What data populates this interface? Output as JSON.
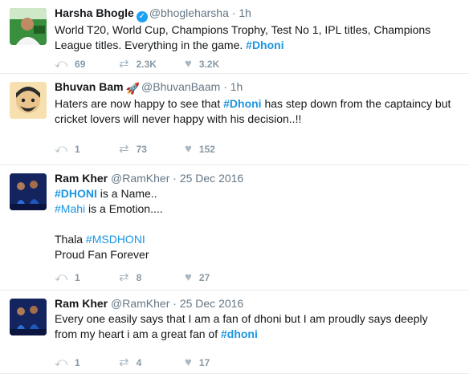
{
  "tweets": [
    {
      "name": "Harsha Bhogle",
      "verified": true,
      "handle": "@bhogleharsha",
      "dot": "·",
      "time": "1h",
      "lines": [
        {
          "parts": [
            {
              "t": "World T20, World Cup, Champions Trophy, Test No 1, IPL titles, Champions"
            }
          ]
        },
        {
          "parts": [
            {
              "t": "League titles. Everything in the game. "
            },
            {
              "t": "#Dhoni",
              "tag": true
            }
          ]
        }
      ],
      "replies": "69",
      "retweets": "2.3K",
      "likes": "3.2K"
    },
    {
      "name": "Bhuvan Bam",
      "emoji": "🚀",
      "handle": "@BhuvanBaam",
      "dot": "·",
      "time": "1h",
      "lines": [
        {
          "parts": [
            {
              "t": "Haters are now happy to see that "
            },
            {
              "t": "#Dhoni",
              "tag": true
            },
            {
              "t": " has step down from the captaincy but"
            }
          ]
        },
        {
          "parts": [
            {
              "t": "cricket lovers will never happy with his decision..!!"
            }
          ]
        }
      ],
      "replies": "1",
      "retweets": "73",
      "likes": "152"
    },
    {
      "name": "Ram Kher",
      "handle": "@RamKher",
      "dot": "·",
      "time": "25 Dec 2016",
      "lines": [
        {
          "parts": [
            {
              "t": "#DHONI",
              "tag": true
            },
            {
              "t": " is a Name.."
            }
          ]
        },
        {
          "parts": [
            {
              "t": "#Mahi",
              "tag": true,
              "plain": true
            },
            {
              "t": " is a Emotion...."
            }
          ]
        },
        {
          "gap": true
        },
        {
          "parts": [
            {
              "t": "Thala "
            },
            {
              "t": "#MSDHONI",
              "tag": true,
              "plain": true
            }
          ]
        },
        {
          "parts": [
            {
              "t": "Proud Fan Forever"
            }
          ]
        }
      ],
      "replies": "1",
      "retweets": "8",
      "likes": "27"
    },
    {
      "name": "Ram Kher",
      "handle": "@RamKher",
      "dot": "·",
      "time": "25 Dec 2016",
      "lines": [
        {
          "parts": [
            {
              "t": "Every one easily says that I am a fan of dhoni but I am proudly says deeply"
            }
          ]
        },
        {
          "parts": [
            {
              "t": "from my heart i am a great fan of "
            },
            {
              "t": "#dhoni",
              "tag": true
            }
          ]
        }
      ],
      "replies": "1",
      "retweets": "4",
      "likes": "17"
    }
  ],
  "icons": {
    "reply": "reply-icon",
    "retweet": "retweet-icon",
    "like": "heart-icon",
    "verified": "verified-badge-icon"
  }
}
